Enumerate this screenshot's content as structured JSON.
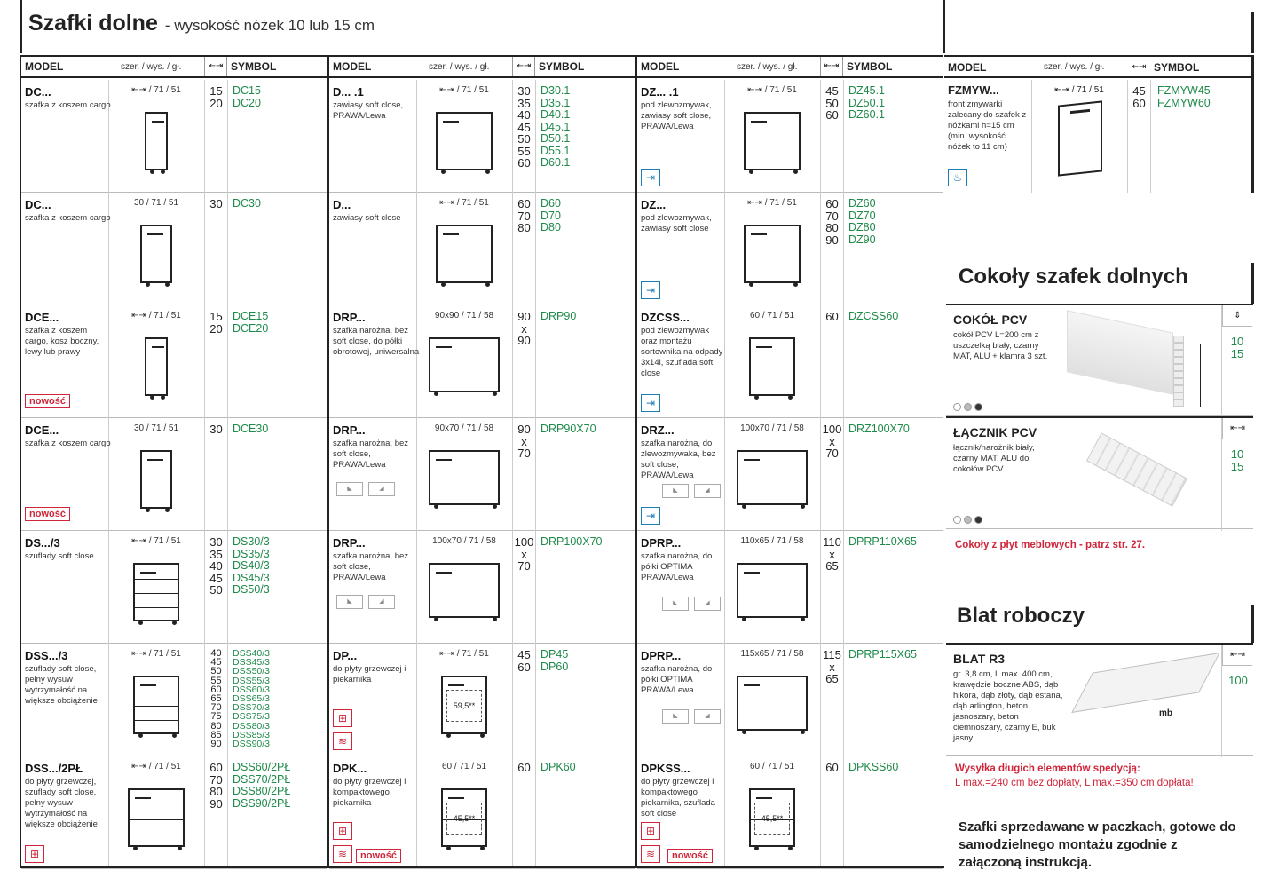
{
  "header": {
    "title": "Szafki dolne",
    "subtitle": "- wysokość nóżek 10 lub 15 cm"
  },
  "table_head": {
    "model": "MODEL",
    "dims": "szer. / wys. / gł.",
    "width_icon": "⇤⇥",
    "symbol": "SYMBOL"
  },
  "columns": [
    {
      "rows": [
        {
          "code": "DC...",
          "desc": "szafka z koszem cargo",
          "dims": "⇤⇥ / 71 / 51",
          "widths": "15\n20",
          "symbols": "DC15\nDC20"
        },
        {
          "code": "DC...",
          "desc": "szafka z koszem cargo",
          "dims": "30 / 71 / 51",
          "widths": "30",
          "symbols": "DC30"
        },
        {
          "code": "DCE...",
          "desc": "szafka z koszem cargo, kosz boczny, lewy lub prawy",
          "dims": "⇤⇥ / 71 / 51",
          "widths": "15\n20",
          "symbols": "DCE15\nDCE20",
          "badge": "nowość"
        },
        {
          "code": "DCE...",
          "desc": "szafka z koszem cargo",
          "dims": "30 / 71 / 51",
          "widths": "30",
          "symbols": "DCE30",
          "badge": "nowość"
        },
        {
          "code": "DS.../3",
          "desc": "szuflady soft close",
          "dims": "⇤⇥ / 71 / 51",
          "widths": "30\n35\n40\n45\n50",
          "symbols": "DS30/3\nDS35/3\nDS40/3\nDS45/3\nDS50/3"
        },
        {
          "code": "DSS.../3",
          "desc": "szuflady soft close, pełny wysuw wytrzymałość na większe obciążenie",
          "dims": "⇤⇥ / 71 / 51",
          "widths": "40\n45\n50\n55\n60\n65\n70\n75\n80\n85\n90",
          "symbols": "DSS40/3\nDSS45/3\nDSS50/3\nDSS55/3\nDSS60/3\nDSS65/3\nDSS70/3\nDSS75/3\nDSS80/3\nDSS85/3\nDSS90/3"
        },
        {
          "code": "DSS.../2PŁ",
          "desc": "do płyty grzewczej, szuflady soft close, pełny wysuw wytrzymałość na większe obciążenie",
          "dims": "⇤⇥ / 71 / 51",
          "widths": "60\n70\n80\n90",
          "symbols": "DSS60/2PŁ\nDSS70/2PŁ\nDSS80/2PŁ\nDSS90/2PŁ"
        }
      ]
    },
    {
      "rows": [
        {
          "code": "D... .1",
          "desc": "zawiasy soft close, PRAWA/Lewa",
          "dims": "⇤⇥ / 71 / 51",
          "widths": "30\n35\n40\n45\n50\n55\n60",
          "symbols": "D30.1\nD35.1\nD40.1\nD45.1\nD50.1\nD55.1\nD60.1"
        },
        {
          "code": "D...",
          "desc": "zawiasy soft close",
          "dims": "⇤⇥ / 71 / 51",
          "widths": "60\n70\n80",
          "symbols": "D60\nD70\nD80"
        },
        {
          "code": "DRP...",
          "desc": "szafka narożna, bez soft close, do półki obrotowej, uniwersalna",
          "dims": "90x90 / 71 / 58",
          "widths": "90\nx\n90",
          "symbols": "DRP90"
        },
        {
          "code": "DRP...",
          "desc": "szafka narożna, bez soft close, PRAWA/Lewa",
          "dims": "90x70 / 71 / 58",
          "widths": "90\nx\n70",
          "symbols": "DRP90X70",
          "lr": true
        },
        {
          "code": "DRP...",
          "desc": "szafka narożna, bez soft close, PRAWA/Lewa",
          "dims": "100x70 / 71 / 58",
          "widths": "100\nx\n70",
          "symbols": "DRP100X70",
          "lr": true
        },
        {
          "code": "DP...",
          "desc": "do płyty grzewczej i piekarnika",
          "dims": "⇤⇥ / 71 / 51",
          "widths": "45\n60",
          "symbols": "DP45\nDP60",
          "oven": "59,5**"
        },
        {
          "code": "DPK...",
          "desc": "do płyty grzewczej i kompaktowego piekarnika",
          "dims": "60 / 71 / 51",
          "widths": "60",
          "symbols": "DPK60",
          "oven": "45,5**",
          "badge": "nowość"
        }
      ]
    },
    {
      "rows": [
        {
          "code": "DZ... .1",
          "desc": "pod zlewozmywak, zawiasy soft close, PRAWA/Lewa",
          "dims": "⇤⇥ / 71 / 51",
          "widths": "45\n50\n60",
          "symbols": "DZ45.1\nDZ50.1\nDZ60.1"
        },
        {
          "code": "DZ...",
          "desc": "pod zlewozmywak, zawiasy soft close",
          "dims": "⇤⇥ / 71 / 51",
          "widths": "60\n70\n80\n90",
          "symbols": "DZ60\nDZ70\nDZ80\nDZ90"
        },
        {
          "code": "DZCSS...",
          "desc": "pod zlewozmywak oraz montażu sortownika na odpady 3x14l, szuflada soft close",
          "dims": "60 / 71 / 51",
          "widths": "60",
          "symbols": "DZCSS60"
        },
        {
          "code": "DRZ...",
          "desc": "szafka narożna, do zlewozmywaka, bez soft close, PRAWA/Lewa",
          "dims": "100x70 / 71 / 58",
          "widths": "100\nx\n70",
          "symbols": "DRZ100X70",
          "lr": true
        },
        {
          "code": "DPRP...",
          "desc": "szafka narożna, do półki OPTIMA PRAWA/Lewa",
          "dims": "110x65 / 71 / 58",
          "widths": "110\nx\n65",
          "symbols": "DPRP110X65",
          "lr": true
        },
        {
          "code": "DPRP...",
          "desc": "szafka narożna, do półki OPTIMA PRAWA/Lewa",
          "dims": "115x65 / 71 / 58",
          "widths": "115\nx\n65",
          "symbols": "DPRP115X65",
          "lr": true
        },
        {
          "code": "DPKSS...",
          "desc": "do płyty grzewczej i kompaktowego piekarnika, szuflada soft close",
          "dims": "60 / 71 / 51",
          "widths": "60",
          "symbols": "DPKSS60",
          "oven": "45,5**",
          "badge": "nowość"
        }
      ]
    }
  ],
  "right": {
    "fzmyw": {
      "code": "FZMYW...",
      "desc": "front zmywarki zalecany do szafek z nóżkami h=15 cm (min. wysokość nóżek to 11 cm)",
      "dims": "⇤⇥ / 71 / 51",
      "widths": "45\n60",
      "symbols": "FZMYW45\nFZMYW60"
    },
    "cokoly_title": "Cokoły szafek dolnych",
    "cokol": {
      "name": "COKÓŁ PCV",
      "desc": "cokół PCV L=200 cm z uszczelką biały, czarny MAT, ALU + klamra 3 szt.",
      "values": "10\n15",
      "icon": "⇕"
    },
    "lacznik": {
      "name": "ŁĄCZNIK PCV",
      "desc": "łącznik/narożnik biały, czarny MAT, ALU do cokołów PCV",
      "values": "10\n15",
      "icon": "⇤⇥"
    },
    "cokoly_note": "Cokoły z płyt meblowych - patrz str. 27.",
    "blat_title": "Blat roboczy",
    "blat": {
      "name": "BLAT R3",
      "desc": "gr. 3,8 cm, L max. 400 cm, krawędzie boczne ABS, dąb hikora, dąb złoty, dąb estana, dąb arlington, beton jasnoszary, beton ciemnoszary, czarny E, buk jasny",
      "value": "100",
      "icon": "⇤⇥",
      "label": "mb"
    },
    "shipping_line1": "Wysyłka długich elementów spedycją:",
    "shipping_line2": "L max.=240 cm bez dopłaty, L max.=350 cm dopłata!",
    "footer": "Szafki sprzedawane w paczkach, gotowe do samodzielnego montażu zgodnie z załączoną instrukcją."
  },
  "colors": {
    "accent_green": "#1e8a4a",
    "accent_red": "#d0253a",
    "accent_blue": "#1b7fb6"
  }
}
